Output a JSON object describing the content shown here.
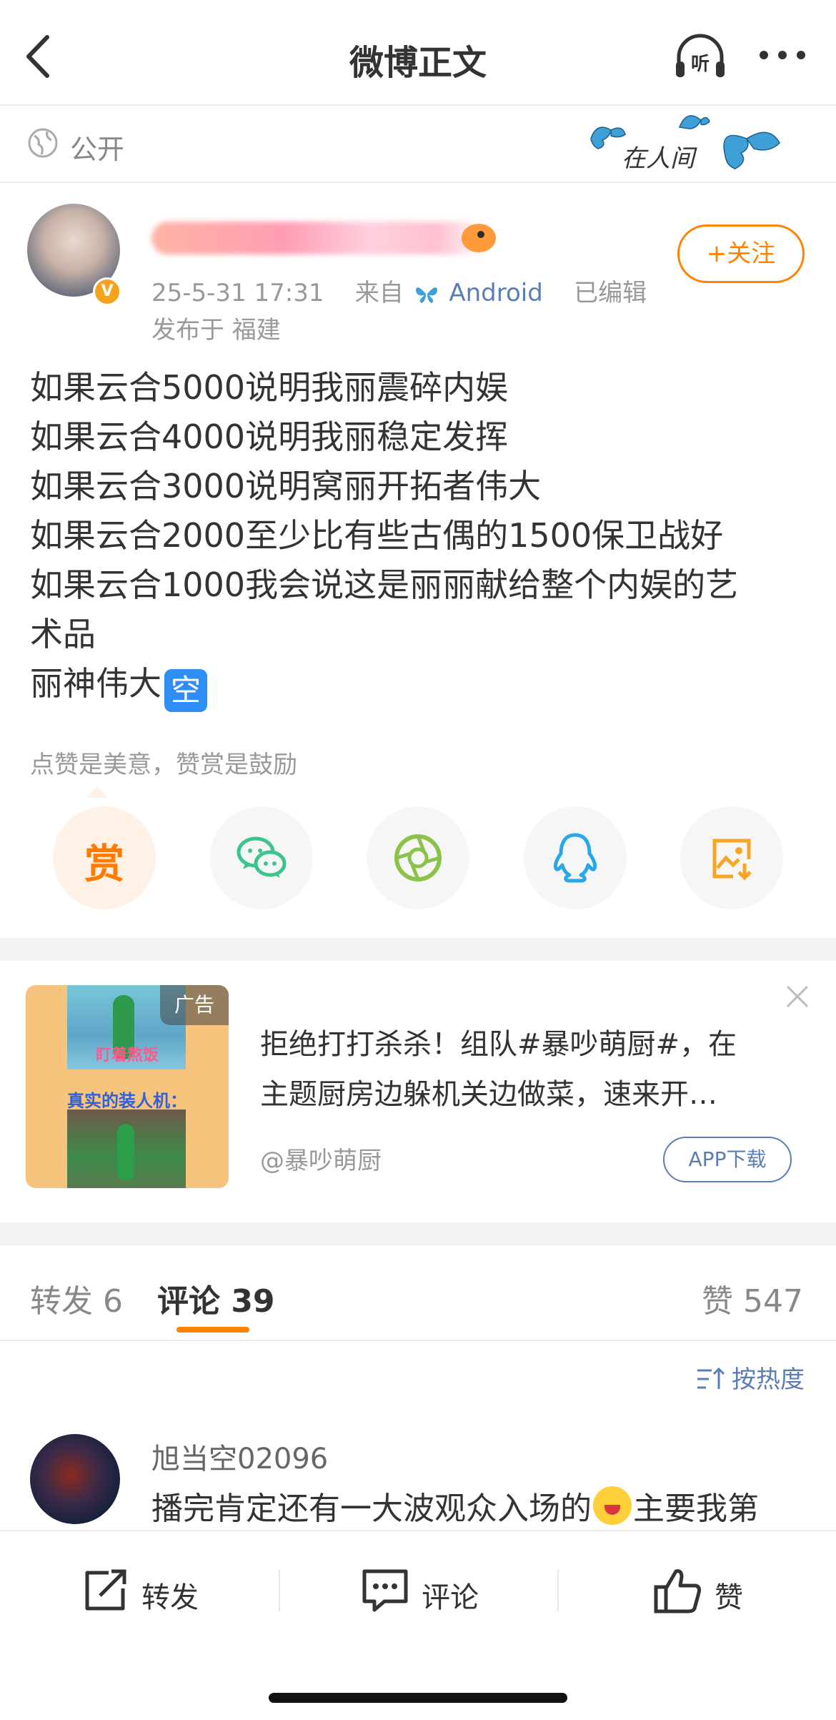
{
  "header": {
    "title": "微博正文"
  },
  "visibility": {
    "label": "公开",
    "decor_text": "在人间"
  },
  "author": {
    "meta_time": "25-5-31 17:31",
    "meta_from": "来自",
    "meta_source": "Android",
    "meta_edited": "已编辑",
    "location": "发布于 福建",
    "follow_label": "+关注",
    "verified_mark": "V"
  },
  "post": {
    "lines": [
      "如果云合5000说明我丽震碎内娱",
      "如果云合4000说明我丽稳定发挥",
      "如果云合3000说明窝丽开拓者伟大",
      "如果云合2000至少比有些古偶的1500保卫战好",
      "如果云合1000我会说这是丽丽献给整个内娱的艺",
      "术品"
    ],
    "last_line_text": "丽神伟大",
    "last_line_badge": "空"
  },
  "reward_hint": "点赞是美意，赞赏是鼓励",
  "share": {
    "reward_glyph": "赏"
  },
  "ad": {
    "tag": "广告",
    "image_caption_1": "盯着熬饭",
    "image_caption_2": "真实的装人机：",
    "text_line_1": "拒绝打打杀杀！组队#暴吵萌厨#，在",
    "text_line_2": "主题厨房边躲机关边做菜，速来开…",
    "source": "@暴吵萌厨",
    "download_label": "APP下载"
  },
  "tabs": {
    "repost_label": "转发 6",
    "comments_label": "评论 39",
    "likes_label": "赞 547"
  },
  "sort": {
    "label": "按热度"
  },
  "comment": {
    "user": "旭当空02096",
    "text_before": "播完肯定还有一大波观众入场的",
    "text_after": "主要我第"
  },
  "bottom_bar": {
    "repost_label": "转发",
    "comment_label": "评论",
    "like_label": "赞"
  },
  "colors": {
    "accent": "#ff8200",
    "link": "#5b7db5",
    "wechat": "#3bc58c",
    "moments": "#8bc34a",
    "qq": "#28a8e8",
    "save": "#f6a623"
  }
}
